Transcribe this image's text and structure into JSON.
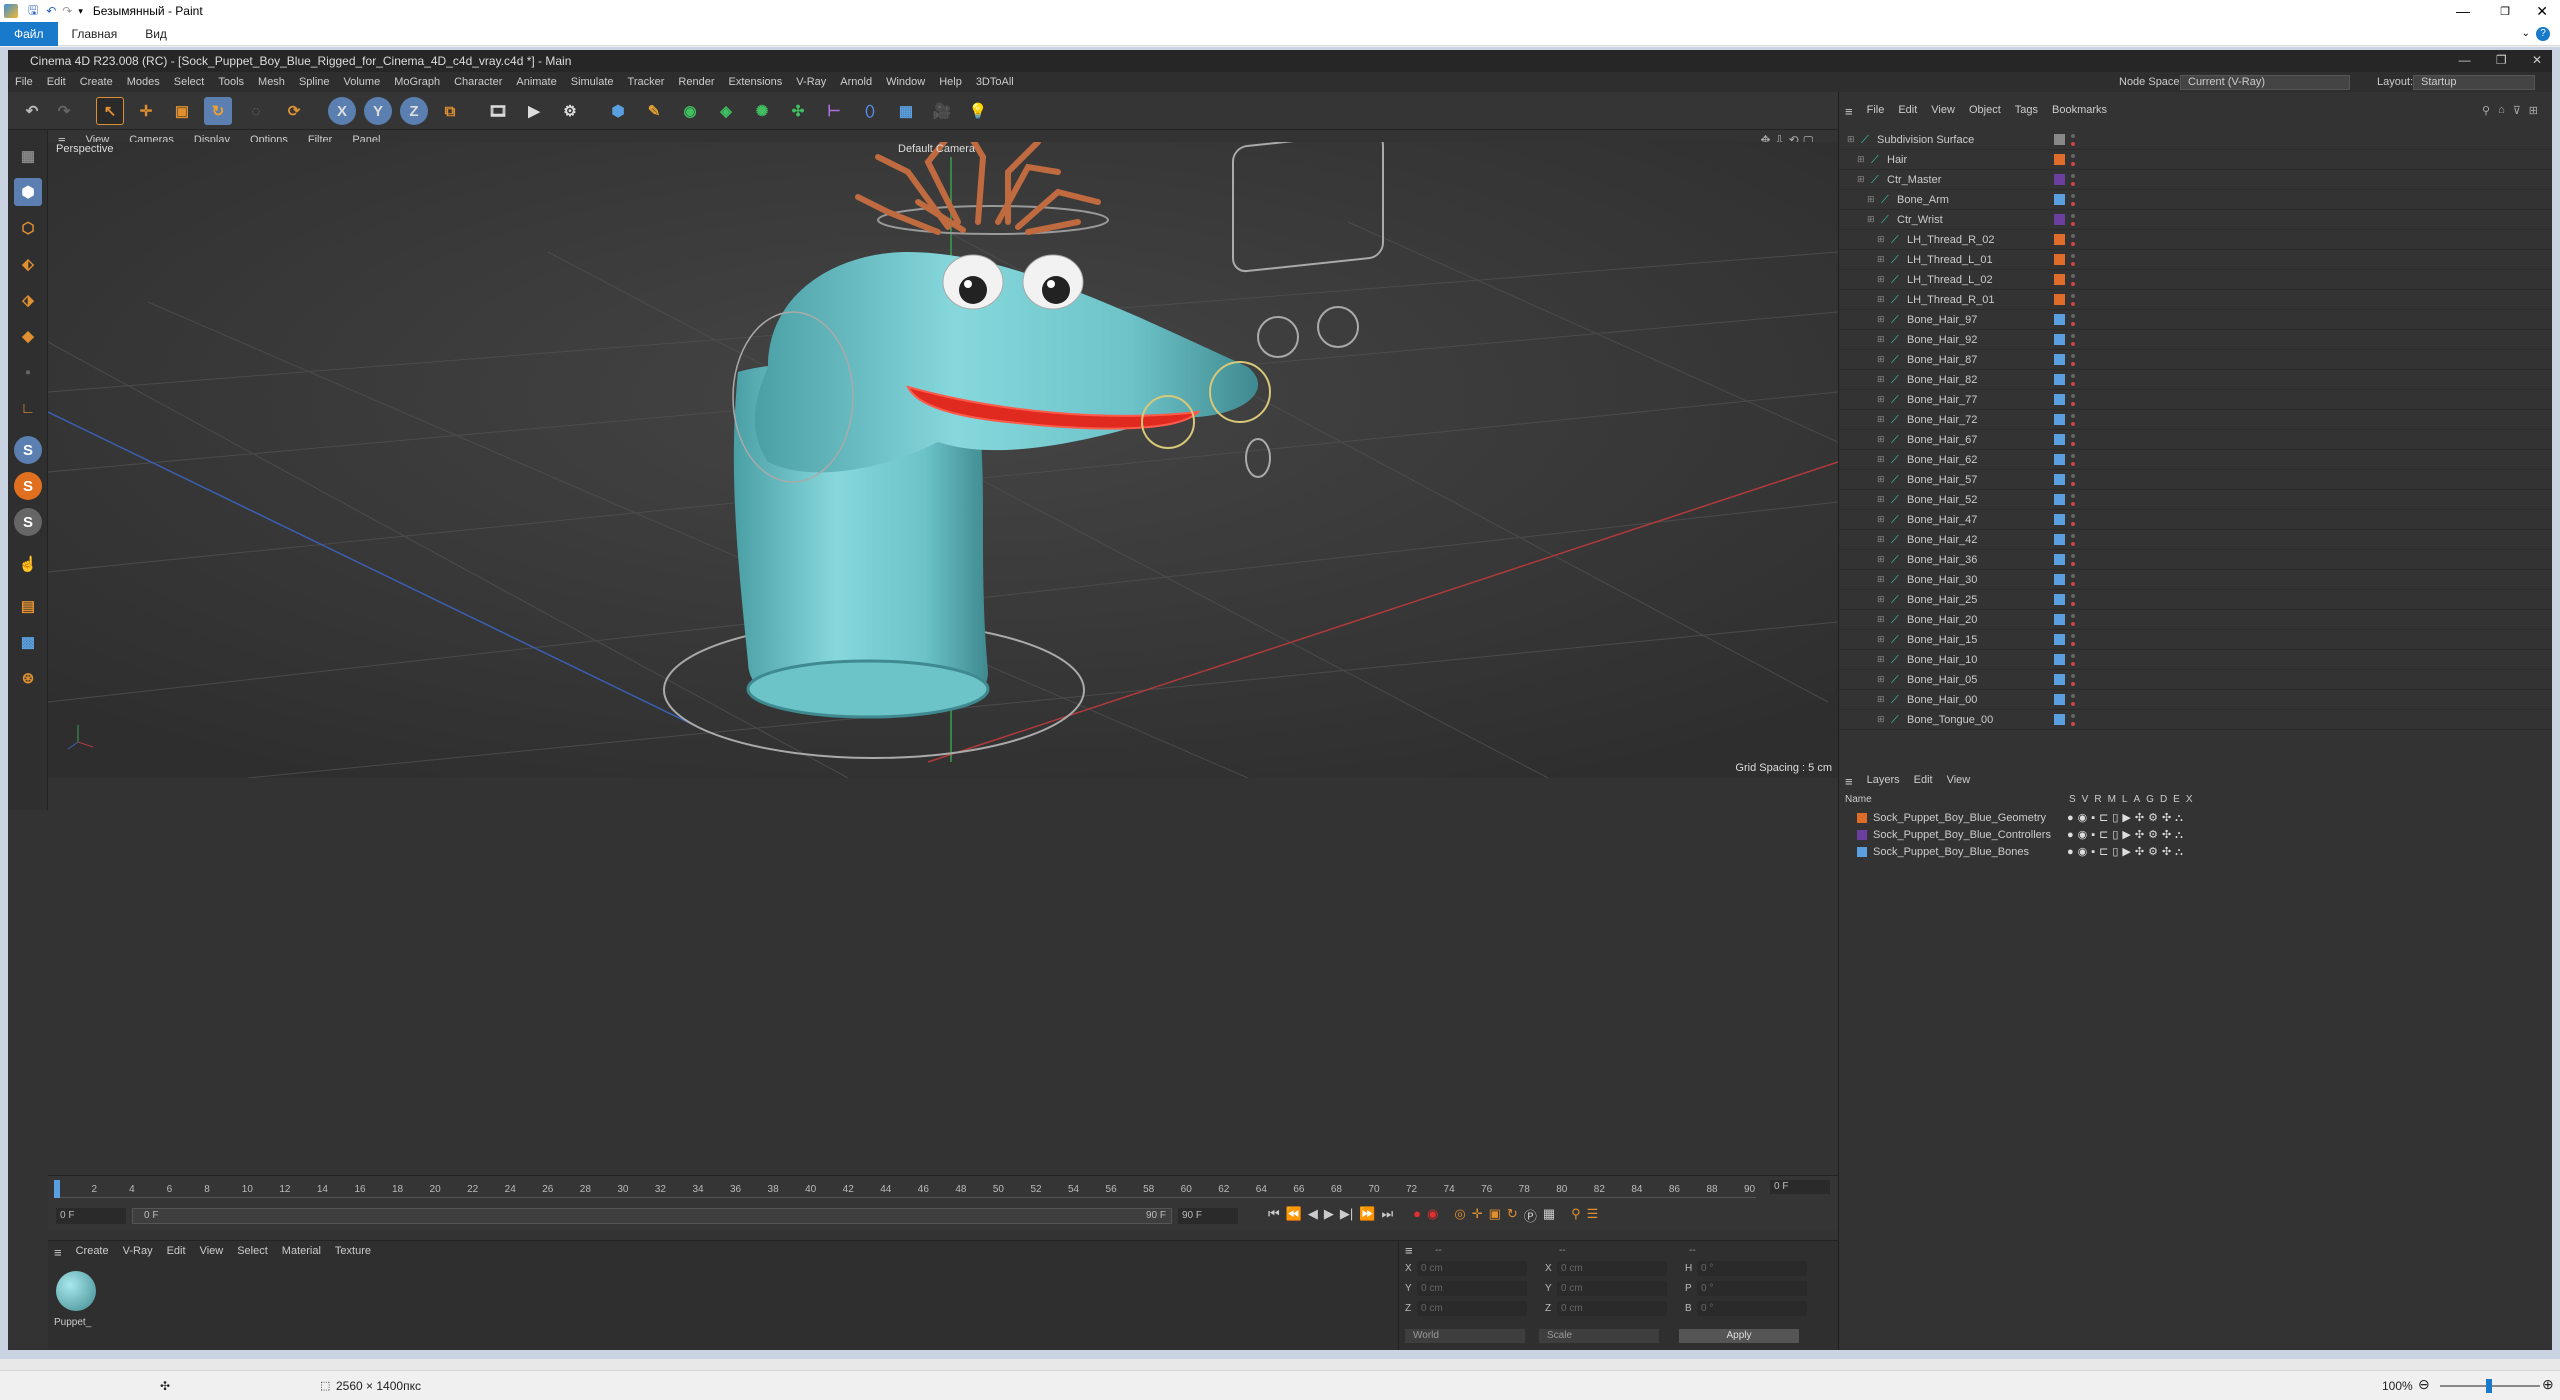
{
  "paint": {
    "title": "Безымянный - Paint",
    "tabs": [
      "Файл",
      "Главная",
      "Вид"
    ],
    "status_size": "2560 × 1400пкс",
    "zoom": "100%"
  },
  "c4d": {
    "title": "Cinema 4D R23.008 (RC) - [Sock_Puppet_Boy_Blue_Rigged_for_Cinema_4D_c4d_vray.c4d *] - Main",
    "menu": [
      "File",
      "Edit",
      "Create",
      "Modes",
      "Select",
      "Tools",
      "Mesh",
      "Spline",
      "Volume",
      "MoGraph",
      "Character",
      "Animate",
      "Simulate",
      "Tracker",
      "Render",
      "Extensions",
      "V-Ray",
      "Arnold",
      "Window",
      "Help",
      "3DToAll"
    ],
    "node_space_label": "Node Space:",
    "node_space_value": "Current (V-Ray)",
    "layout_label": "Layout:",
    "layout_value": "Startup",
    "viewport": {
      "menu": [
        "View",
        "Cameras",
        "Display",
        "Options",
        "Filter",
        "Panel"
      ],
      "view_name": "Perspective",
      "camera": "Default Camera",
      "grid_spacing": "Grid Spacing : 5 cm"
    },
    "timeline": {
      "ticks": [
        "0",
        "2",
        "4",
        "6",
        "8",
        "10",
        "12",
        "14",
        "16",
        "18",
        "20",
        "22",
        "24",
        "26",
        "28",
        "30",
        "32",
        "34",
        "36",
        "38",
        "40",
        "42",
        "44",
        "46",
        "48",
        "50",
        "52",
        "54",
        "56",
        "58",
        "60",
        "62",
        "64",
        "66",
        "68",
        "70",
        "72",
        "74",
        "76",
        "78",
        "80",
        "82",
        "84",
        "86",
        "88",
        "90"
      ],
      "current_frame": "0 F",
      "start_field": "0 F",
      "range_start": "0 F",
      "range_end": "90 F",
      "end_field": "90 F",
      "right_field": "0 F"
    },
    "material_panel": {
      "menu": [
        "Create",
        "V-Ray",
        "Edit",
        "View",
        "Select",
        "Material",
        "Texture"
      ],
      "material_name": "Puppet_"
    },
    "coords": {
      "rows": [
        {
          "a": "X",
          "av": "0 cm",
          "b": "X",
          "bv": "0 cm",
          "c": "H",
          "cv": "0 °"
        },
        {
          "a": "Y",
          "av": "0 cm",
          "b": "Y",
          "bv": "0 cm",
          "c": "P",
          "cv": "0 °"
        },
        {
          "a": "Z",
          "av": "0 cm",
          "b": "Z",
          "bv": "0 cm",
          "c": "B",
          "cv": "0 °"
        }
      ],
      "world": "World",
      "scale": "Scale",
      "apply": "Apply",
      "header_a": "--",
      "header_b": "--",
      "header_c": "--"
    },
    "object_manager": {
      "menu": [
        "File",
        "Edit",
        "View",
        "Object",
        "Tags",
        "Bookmarks"
      ],
      "objects": [
        {
          "name": "Subdivision Surface",
          "indent": 0,
          "color": "#888888"
        },
        {
          "name": "Hair",
          "indent": 1,
          "color": "#e06c2a"
        },
        {
          "name": "Ctr_Master",
          "indent": 1,
          "color": "#6a3fa0"
        },
        {
          "name": "Bone_Arm",
          "indent": 2,
          "color": "#5aa0e0"
        },
        {
          "name": "Ctr_Wrist",
          "indent": 2,
          "color": "#6a3fa0"
        },
        {
          "name": "LH_Thread_R_02",
          "indent": 3,
          "color": "#e06c2a"
        },
        {
          "name": "LH_Thread_L_01",
          "indent": 3,
          "color": "#e06c2a"
        },
        {
          "name": "LH_Thread_L_02",
          "indent": 3,
          "color": "#e06c2a"
        },
        {
          "name": "LH_Thread_R_01",
          "indent": 3,
          "color": "#e06c2a"
        },
        {
          "name": "Bone_Hair_97",
          "indent": 3,
          "color": "#5aa0e0"
        },
        {
          "name": "Bone_Hair_92",
          "indent": 3,
          "color": "#5aa0e0"
        },
        {
          "name": "Bone_Hair_87",
          "indent": 3,
          "color": "#5aa0e0"
        },
        {
          "name": "Bone_Hair_82",
          "indent": 3,
          "color": "#5aa0e0"
        },
        {
          "name": "Bone_Hair_77",
          "indent": 3,
          "color": "#5aa0e0"
        },
        {
          "name": "Bone_Hair_72",
          "indent": 3,
          "color": "#5aa0e0"
        },
        {
          "name": "Bone_Hair_67",
          "indent": 3,
          "color": "#5aa0e0"
        },
        {
          "name": "Bone_Hair_62",
          "indent": 3,
          "color": "#5aa0e0"
        },
        {
          "name": "Bone_Hair_57",
          "indent": 3,
          "color": "#5aa0e0"
        },
        {
          "name": "Bone_Hair_52",
          "indent": 3,
          "color": "#5aa0e0"
        },
        {
          "name": "Bone_Hair_47",
          "indent": 3,
          "color": "#5aa0e0"
        },
        {
          "name": "Bone_Hair_42",
          "indent": 3,
          "color": "#5aa0e0"
        },
        {
          "name": "Bone_Hair_36",
          "indent": 3,
          "color": "#5aa0e0"
        },
        {
          "name": "Bone_Hair_30",
          "indent": 3,
          "color": "#5aa0e0"
        },
        {
          "name": "Bone_Hair_25",
          "indent": 3,
          "color": "#5aa0e0"
        },
        {
          "name": "Bone_Hair_20",
          "indent": 3,
          "color": "#5aa0e0"
        },
        {
          "name": "Bone_Hair_15",
          "indent": 3,
          "color": "#5aa0e0"
        },
        {
          "name": "Bone_Hair_10",
          "indent": 3,
          "color": "#5aa0e0"
        },
        {
          "name": "Bone_Hair_05",
          "indent": 3,
          "color": "#5aa0e0"
        },
        {
          "name": "Bone_Hair_00",
          "indent": 3,
          "color": "#5aa0e0"
        },
        {
          "name": "Bone_Tongue_00",
          "indent": 3,
          "color": "#5aa0e0"
        }
      ]
    },
    "layer_manager": {
      "menu": [
        "Layers",
        "Edit",
        "View"
      ],
      "name_header": "Name",
      "col_headers": [
        "S",
        "V",
        "R",
        "M",
        "L",
        "A",
        "G",
        "D",
        "E",
        "X"
      ],
      "layers": [
        {
          "name": "Sock_Puppet_Boy_Blue_Geometry",
          "color": "#e06c2a"
        },
        {
          "name": "Sock_Puppet_Boy_Blue_Controllers",
          "color": "#6a3fa0"
        },
        {
          "name": "Sock_Puppet_Boy_Blue_Bones",
          "color": "#5aa0e0"
        }
      ]
    }
  }
}
